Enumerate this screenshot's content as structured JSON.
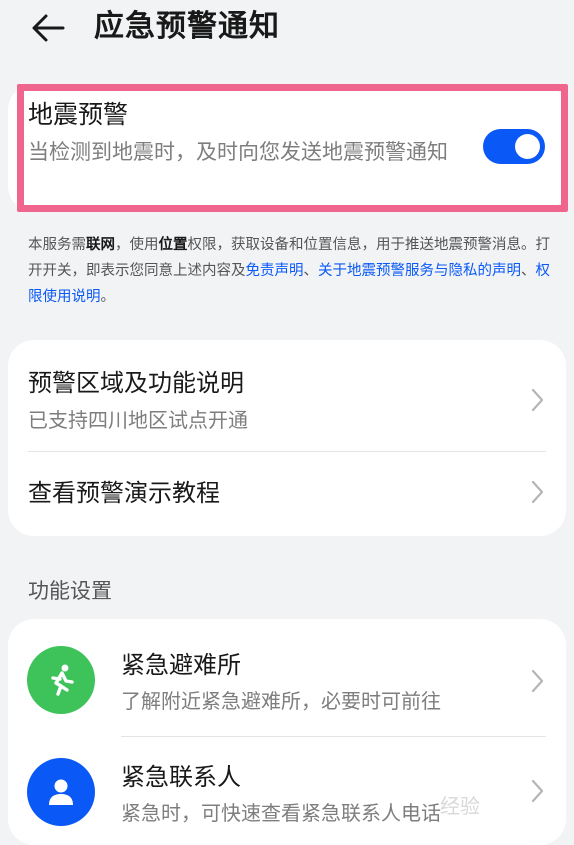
{
  "header": {
    "title": "应急预警通知"
  },
  "earthquake": {
    "title": "地震预警",
    "description": "当检测到地震时，及时向您发送地震预警通知",
    "enabled": true
  },
  "notice": {
    "p1": "本服务需",
    "b1": "联网",
    "p2": "，使用",
    "b2": "位置",
    "p3": "权限，获取设备和位置信息，用于推送地震预警消息。打开开关，即表示您同意上述内容及",
    "link1": "免责声明",
    "sep1": "、",
    "link2": "关于地震预警服务与隐私的声明",
    "sep2": "、",
    "link3": "权限使用说明",
    "end": "。"
  },
  "info_items": [
    {
      "title": "预警区域及功能说明",
      "subtitle": "已支持四川地区试点开通"
    },
    {
      "title": "查看预警演示教程"
    }
  ],
  "section_label": "功能设置",
  "functions": [
    {
      "title": "紧急避难所",
      "subtitle": "了解附近紧急避难所，必要时可前往",
      "icon": "running-person-icon",
      "color": "#3ec25a"
    },
    {
      "title": "紧急联系人",
      "subtitle": "紧急时，可快速查看紧急联系人电话",
      "icon": "person-icon",
      "color": "#0a59f7"
    }
  ],
  "watermark": "经验"
}
